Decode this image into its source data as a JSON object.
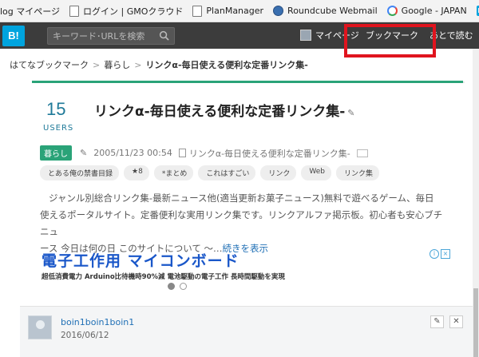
{
  "bookmarks": [
    {
      "label": "log マイページ",
      "icon": "page-icon"
    },
    {
      "label": "ログイン | GMOクラウド",
      "icon": "page-icon"
    },
    {
      "label": "PlanManager",
      "icon": "page-icon"
    },
    {
      "label": "Roundcube Webmail",
      "icon": "globe-icon"
    },
    {
      "label": "Google - JAPAN",
      "icon": "google-icon"
    },
    {
      "label": "",
      "icon": "hatena-icon"
    }
  ],
  "header": {
    "logo": "B!",
    "search_placeholder": "キーワード･URLを検索",
    "mypage": "マイページ",
    "bookmark": "ブックマーク",
    "readlater": "あとで読む"
  },
  "breadcrumb": {
    "home": "はてなブックマーク",
    "category": "暮らし",
    "current": "リンクα-毎日使える便利な定番リンク集-"
  },
  "entry": {
    "users_count": "15",
    "users_label": "USERS",
    "title": "リンクα-毎日使える便利な定番リンク集-",
    "category": "暮らし",
    "date": "2005/11/23 00:54",
    "source_title": "リンクα-毎日使える便利な定番リンク集-",
    "tags": [
      "とある俺の禁書目録",
      "★8",
      "*まとめ",
      "これはすごい",
      "リンク",
      "Web",
      "リンク集"
    ],
    "desc_line1": "ジャンル別総合リンク集-最新ニュース他(適当更新お菓子ニュース)無料で遊べるゲーム、毎日",
    "desc_line2": "使えるポータルサイト。定番便利な実用リンク集です。リンクアルファ掲示板。初心者も安心ブチニュ",
    "desc_line3": "ース 今日は何の日 このサイトについて 〜…",
    "more": "続きを表示"
  },
  "ad": {
    "title": "電子工作用 マイコンボード",
    "sub": "超低消費電力 Arduino比待機時90%減 電池駆動の電子工作 長時間駆動を実現",
    "info": "i",
    "close": "×"
  },
  "comment": {
    "user": "boin1boin1boin1",
    "date": "2016/06/12"
  },
  "colors": {
    "header_bg": "#3c3c3c",
    "brand": "#00a4de",
    "accent_green": "#2aa378",
    "highlight": "#e0141e"
  }
}
